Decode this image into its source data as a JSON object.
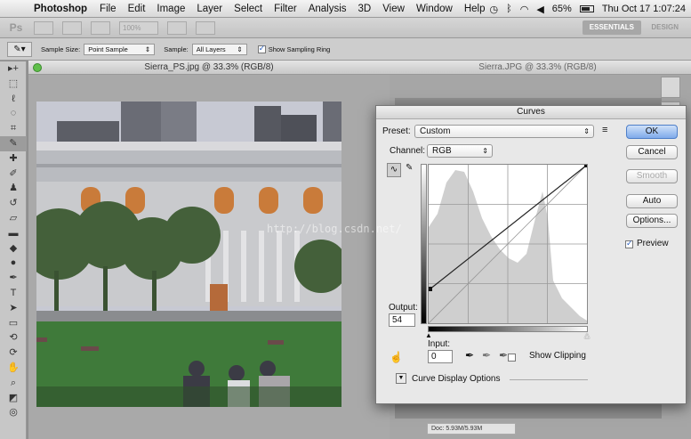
{
  "menubar": {
    "app": "Photoshop",
    "items": [
      "File",
      "Edit",
      "Image",
      "Layer",
      "Select",
      "Filter",
      "Analysis",
      "3D",
      "View",
      "Window",
      "Help"
    ],
    "battery": "65%",
    "clock": "Thu Oct 17  1:07:24"
  },
  "appbar": {
    "logo": "Ps",
    "zoom": "100%",
    "essentials": "ESSENTIALS",
    "design": "DESIGN"
  },
  "options": {
    "sample_size_label": "Sample Size:",
    "sample_size_value": "Point Sample",
    "sample_label": "Sample:",
    "sample_value": "All Layers",
    "show_ring_label": "Show Sampling Ring"
  },
  "document": {
    "title": "Sierra_PS.jpg @ 33.3% (RGB/8)",
    "watermark": "http://blog.csdn.net/"
  },
  "document2": {
    "title": "Sierra.JPG @ 33.3% (RGB/8)",
    "status": "Doc: 5.93M/5.93M"
  },
  "curves": {
    "title": "Curves",
    "preset_label": "Preset:",
    "preset_value": "Custom",
    "channel_label": "Channel:",
    "channel_value": "RGB",
    "output_label": "Output:",
    "output_value": "54",
    "input_label": "Input:",
    "input_value": "0",
    "show_clipping": "Show Clipping",
    "display_options": "Curve Display Options",
    "preview": "Preview",
    "buttons": {
      "ok": "OK",
      "cancel": "Cancel",
      "smooth": "Smooth",
      "auto": "Auto",
      "options": "Options..."
    },
    "curve_point": {
      "input": 0,
      "output": 54
    }
  }
}
